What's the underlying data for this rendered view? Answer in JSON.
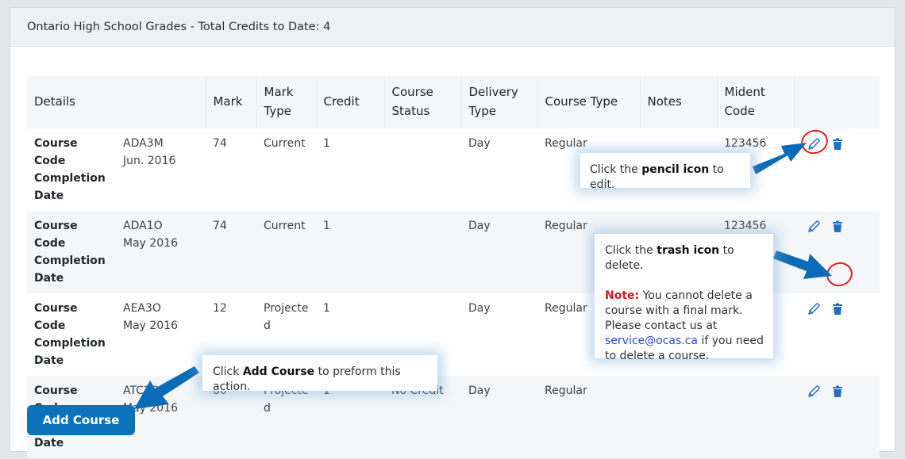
{
  "header": {
    "title": "Ontario High School Grades - Total Credits to Date: 4"
  },
  "table": {
    "columns": [
      {
        "line1": "Details",
        "line2": ""
      },
      {
        "line1": "Mark",
        "line2": ""
      },
      {
        "line1": "Mark",
        "line2": "Type"
      },
      {
        "line1": "Credit",
        "line2": ""
      },
      {
        "line1": "Course",
        "line2": "Status"
      },
      {
        "line1": "Delivery",
        "line2": "Type"
      },
      {
        "line1": "Course Type",
        "line2": ""
      },
      {
        "line1": "Notes",
        "line2": ""
      },
      {
        "line1": "Mident",
        "line2": "Code"
      },
      {
        "line1": "",
        "line2": ""
      }
    ],
    "detail_labels": {
      "code": "Course Code",
      "completion1": "Completion",
      "completion2": "Date"
    },
    "rows": [
      {
        "course_code": "ADA3M",
        "completion_date": "Jun. 2016",
        "mark": "74",
        "mark_type1": "Current",
        "mark_type2": "",
        "credit": "1",
        "course_status": "",
        "delivery_type": "Day",
        "course_type": "Regular",
        "notes": "",
        "mident_code": "123456"
      },
      {
        "course_code": "ADA1O",
        "completion_date": "May 2016",
        "mark": "74",
        "mark_type1": "Current",
        "mark_type2": "",
        "credit": "1",
        "course_status": "",
        "delivery_type": "Day",
        "course_type": "Regular",
        "notes": "",
        "mident_code": "123456"
      },
      {
        "course_code": "AEA3O",
        "completion_date": "May 2016",
        "mark": "12",
        "mark_type1": "Projecte",
        "mark_type2": "d",
        "credit": "1",
        "course_status": "",
        "delivery_type": "Day",
        "course_type": "Regular",
        "notes": "",
        "mident_code": ""
      },
      {
        "course_code": "ATC2O",
        "completion_date": "May 2016",
        "mark": "80",
        "mark_type1": "Projecte",
        "mark_type2": "d",
        "credit": "1",
        "course_status": "No Credit",
        "delivery_type": "Day",
        "course_type": "Regular",
        "notes": "",
        "mident_code": ""
      }
    ],
    "icons": {
      "edit": "pencil-icon",
      "delete": "trash-icon"
    }
  },
  "actions": {
    "add_course_label": "Add Course"
  },
  "callouts": {
    "edit": {
      "pre": "Click the ",
      "bold": "pencil icon",
      "post": " to edit."
    },
    "delete": {
      "pre": "Click the ",
      "bold": "trash icon",
      "post": " to delete.",
      "note_label": "Note:",
      "note_line1": " You cannot delete a",
      "note_line2": "course with a final mark.",
      "note_line3": "Please contact us at",
      "email": "service@ocas.ca",
      "note_line4": " if you need",
      "note_line5": "to delete a course."
    },
    "add": {
      "pre": "Click ",
      "bold": "Add Course",
      "post": " to preform this action."
    }
  },
  "colors": {
    "primary": "#0b72bb",
    "annotation_arrow": "#0a6cb8",
    "highlight_ring": "#e41b1b",
    "note": "#e0141e",
    "link": "#2b46d6"
  }
}
